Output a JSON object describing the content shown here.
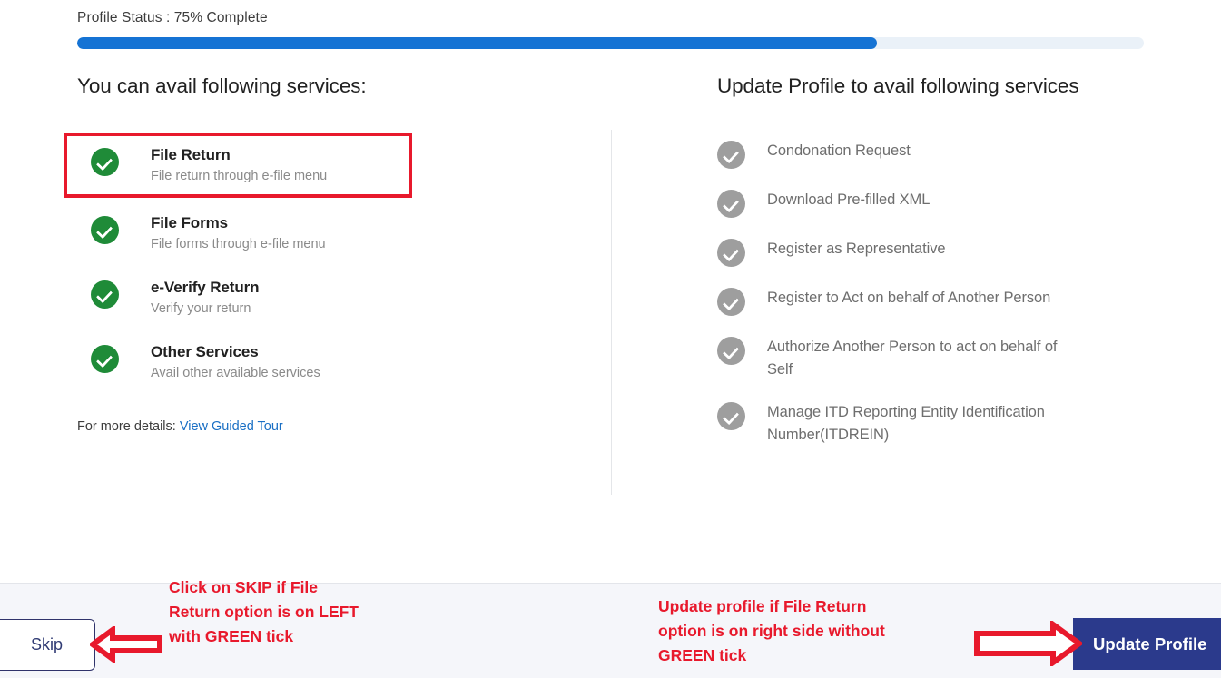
{
  "progress": {
    "label": "Profile Status : 75% Complete",
    "percent": 75,
    "fill_color": "#1573d4",
    "track_color": "#eaf1f8"
  },
  "left_column": {
    "heading": "You can avail following services:",
    "tick_color": "#1f8b38",
    "services": [
      {
        "title": "File Return",
        "subtitle": "File return through e-file menu",
        "highlighted": true,
        "highlight_color": "#e8192c"
      },
      {
        "title": "File Forms",
        "subtitle": "File forms through e-file menu",
        "highlighted": false
      },
      {
        "title": "e-Verify Return",
        "subtitle": "Verify your return",
        "highlighted": false
      },
      {
        "title": "Other Services",
        "subtitle": "Avail other available services",
        "highlighted": false
      }
    ],
    "more_details_prefix": "For more details: ",
    "guided_tour_link": "View Guided Tour",
    "link_color": "#1a6fc4"
  },
  "right_column": {
    "heading": "Update Profile to avail following services",
    "tick_color": "#9e9e9e",
    "services": [
      {
        "label": "Condonation Request"
      },
      {
        "label": "Download Pre-filled XML"
      },
      {
        "label": "Register as Representative"
      },
      {
        "label": "Register to Act on behalf of Another Person"
      },
      {
        "label": "Authorize Another Person to act on behalf of Self"
      },
      {
        "label": "Manage ITD Reporting Entity Identification Number(ITDREIN)"
      }
    ]
  },
  "footer": {
    "skip_label": "Skip",
    "update_profile_label": "Update Profile",
    "update_profile_color": "#2b3a8c",
    "background": "#f5f6fa",
    "annotation_color": "#e8192c",
    "annotation_left": "Click on SKIP if File Return option is on LEFT with GREEN tick",
    "annotation_right": "Update profile if File Return option is on right side without GREEN tick"
  }
}
